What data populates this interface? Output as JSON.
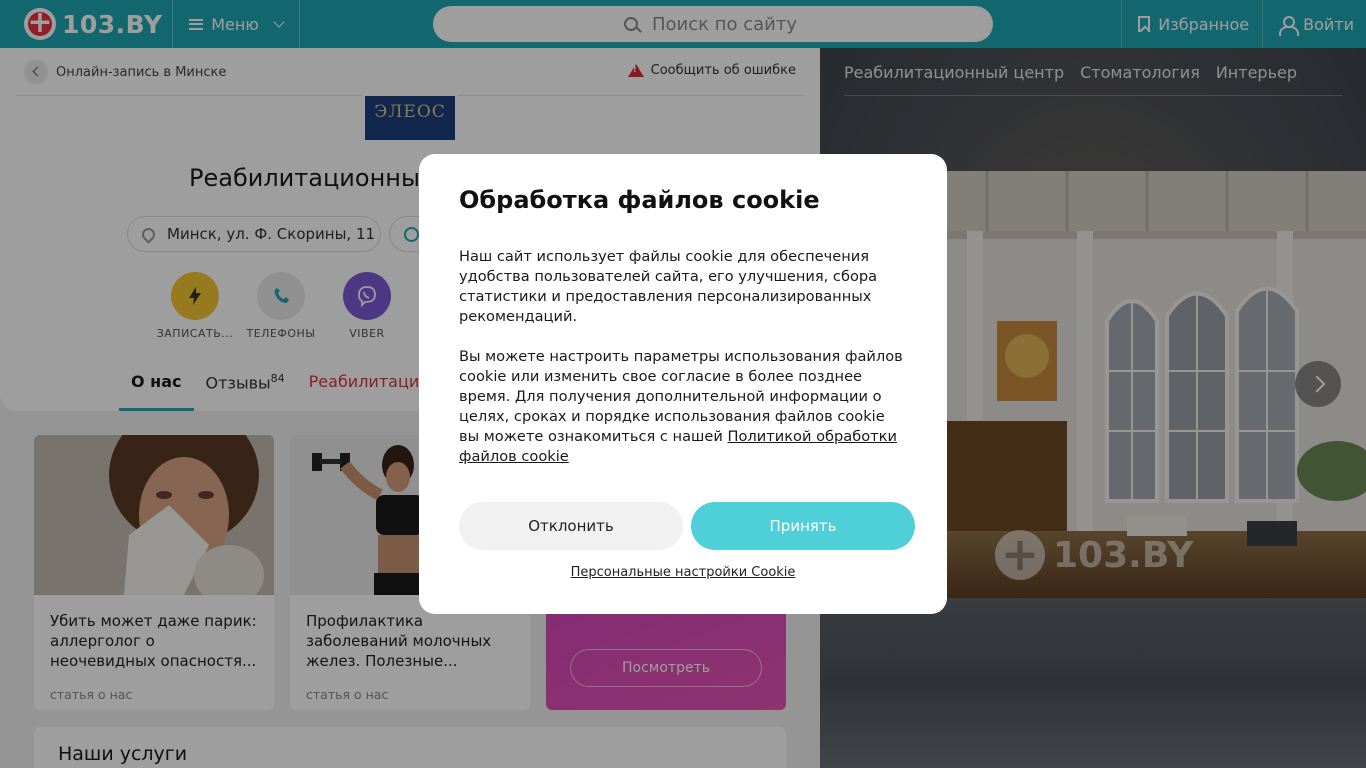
{
  "header": {
    "logo_text": "103.BY",
    "menu_label": "Меню",
    "search_placeholder": "Поиск по сайту",
    "favorites_label": "Избранное",
    "login_label": "Войти"
  },
  "page": {
    "breadcrumb": "Онлайн-запись в Минске",
    "report_error": "Сообщить об ошибке",
    "clinic_logo_text": "ЭЛЕОС",
    "clinic_title": "Реабилитационный",
    "address": "Минск, ул. Ф. Скорины, 11",
    "actions": [
      {
        "label": "ЗАПИСАТЬ...",
        "color": "#f2c530"
      },
      {
        "label": "ТЕЛЕФОНЫ",
        "color": "#e9e9e9"
      },
      {
        "label": "VIBER",
        "color": "#7b5bd6"
      }
    ],
    "tabs": [
      {
        "label": "О нас"
      },
      {
        "label": "Отзывы",
        "count": "84"
      },
      {
        "label": "Реабилитация"
      }
    ]
  },
  "articles": [
    {
      "title": "Убить может даже парик: аллерголог о неочевидных опасностя...",
      "tag": "статья о нас"
    },
    {
      "title": "Профилактика заболеваний молочных желез. Полезные...",
      "tag": "статья о нас"
    }
  ],
  "promo": {
    "button_label": "Посмотреть"
  },
  "services_title": "Наши услуги",
  "gallery": {
    "tabs": [
      "Реабилитационный центр",
      "Стоматология",
      "Интерьер"
    ],
    "watermark": "103.BY"
  },
  "cookie_modal": {
    "title": "Обработка файлов cookie",
    "paragraph1": "Наш сайт использует файлы cookie для обеспечения удобства пользователей сайта, его улучшения, сбора статистики и предоставления персонализированных рекомендаций.",
    "paragraph2": "Вы можете настроить параметры использования файлов cookie или изменить свое согласие в более позднее время. Для получения дополнительной информации о целях, сроках и порядке использования файлов cookie вы можете ознакомиться с нашей",
    "policy_link": "Политикой обработки файлов cookie",
    "decline_label": "Отклонить",
    "accept_label": "Принять",
    "settings_link": "Персональные настройки Cookie"
  },
  "colors": {
    "brand": "#1fa9b3",
    "accept": "#4fcfd8",
    "accent_red": "#d9323f"
  }
}
